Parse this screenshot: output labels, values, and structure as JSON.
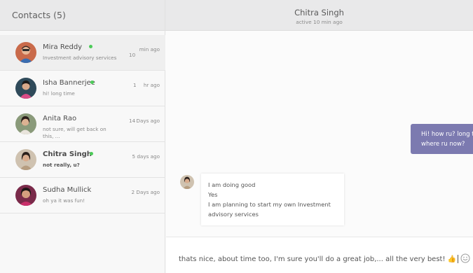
{
  "sidebar": {
    "title": "Contacts (5)",
    "contacts": [
      {
        "name": "Mira Reddy",
        "preview": "Investment advisory services",
        "time": "min ago",
        "unread": "10"
      },
      {
        "name": "Isha Bannerjee",
        "preview": "hi! long time",
        "time": "hr ago",
        "unread": "1"
      },
      {
        "name": "Anita Rao",
        "preview": "not sure, will get back on this, ...",
        "time": "Days ago",
        "unread": "14"
      },
      {
        "name": "Chitra Singh",
        "preview": "not really, u?",
        "time": "5 days ago",
        "unread": ""
      },
      {
        "name": "Sudha Mullick",
        "preview": "oh ya it was fun!",
        "time": "2 Days ago",
        "unread": ""
      }
    ]
  },
  "chat": {
    "title": "Chitra Singh",
    "status": "active 10 min ago",
    "outgoing": [
      "Hi! how ru? long tim",
      "where ru now?"
    ],
    "incoming": [
      "I am doing good",
      "Yes",
      "I am planning to start my own Investment",
      "advisory services"
    ],
    "composer_text": "thats nice, about time too, I'm sure you'll do a great job,... all the very best! 👍"
  },
  "colors": {
    "online": "#4ccb58",
    "outgoing_bubble": "#7c7ab0",
    "header": "#e9e9ea"
  },
  "icons": [
    "smiley-icon",
    "online-status-icon",
    "thumbs-up-icon"
  ]
}
